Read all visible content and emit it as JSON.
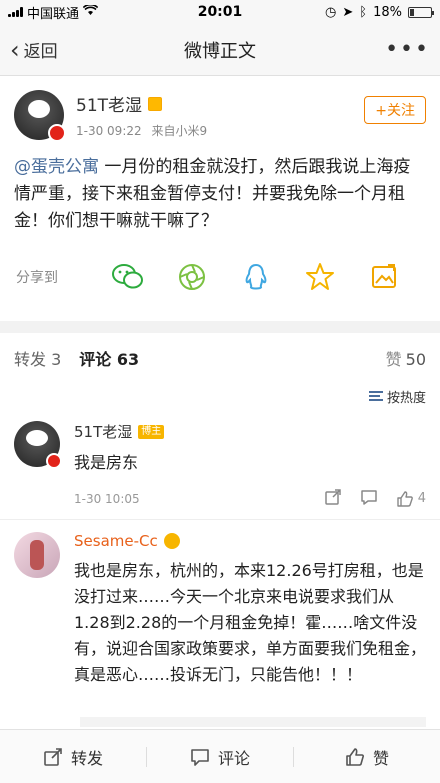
{
  "status_bar": {
    "carrier": "中国联通",
    "time": "20:01",
    "battery": "18%"
  },
  "nav": {
    "back_label": "返回",
    "title": "微博正文",
    "more": "•••"
  },
  "post": {
    "author": "51T老湿",
    "time": "1-30 09:22",
    "source": "来自小米9",
    "follow_label": "+关注",
    "mention": "@蛋壳公寓",
    "text": " 一月份的租金就没打，然后跟我说上海疫情严重，接下来租金暂停支付！并要我免除一个月租金！你们想干嘛就干嘛了？"
  },
  "share": {
    "label": "分享到",
    "icons": [
      "wechat-icon",
      "moments-icon",
      "qq-icon",
      "qzone-icon",
      "image-share-icon"
    ]
  },
  "tabs": {
    "repost": "转发 3",
    "comment": "评论 63",
    "likes_label": "赞",
    "likes_count": "50"
  },
  "sort_label": "按热度",
  "comments": [
    {
      "name": "51T老湿",
      "tag": "博主",
      "text": "我是房东",
      "time": "1-30 10:05",
      "likes": "4"
    },
    {
      "name": "Sesame-Cc",
      "text": "我也是房东，杭州的，本来12.26号打房租，也是没打过来……今天一个北京来电说要求我们从1.28到2.28的一个月租金免掉！霍……啥文件没有，说迎合国家政策要求，单方面要我们免租金，真是恶心……投诉无门，只能告他！！！"
    }
  ],
  "bottom_bar": {
    "repost": "转发",
    "comment": "评论",
    "like": "赞"
  },
  "colors": {
    "accent": "#f08000",
    "link": "#4a6e9c",
    "username_orange": "#e8611b"
  }
}
